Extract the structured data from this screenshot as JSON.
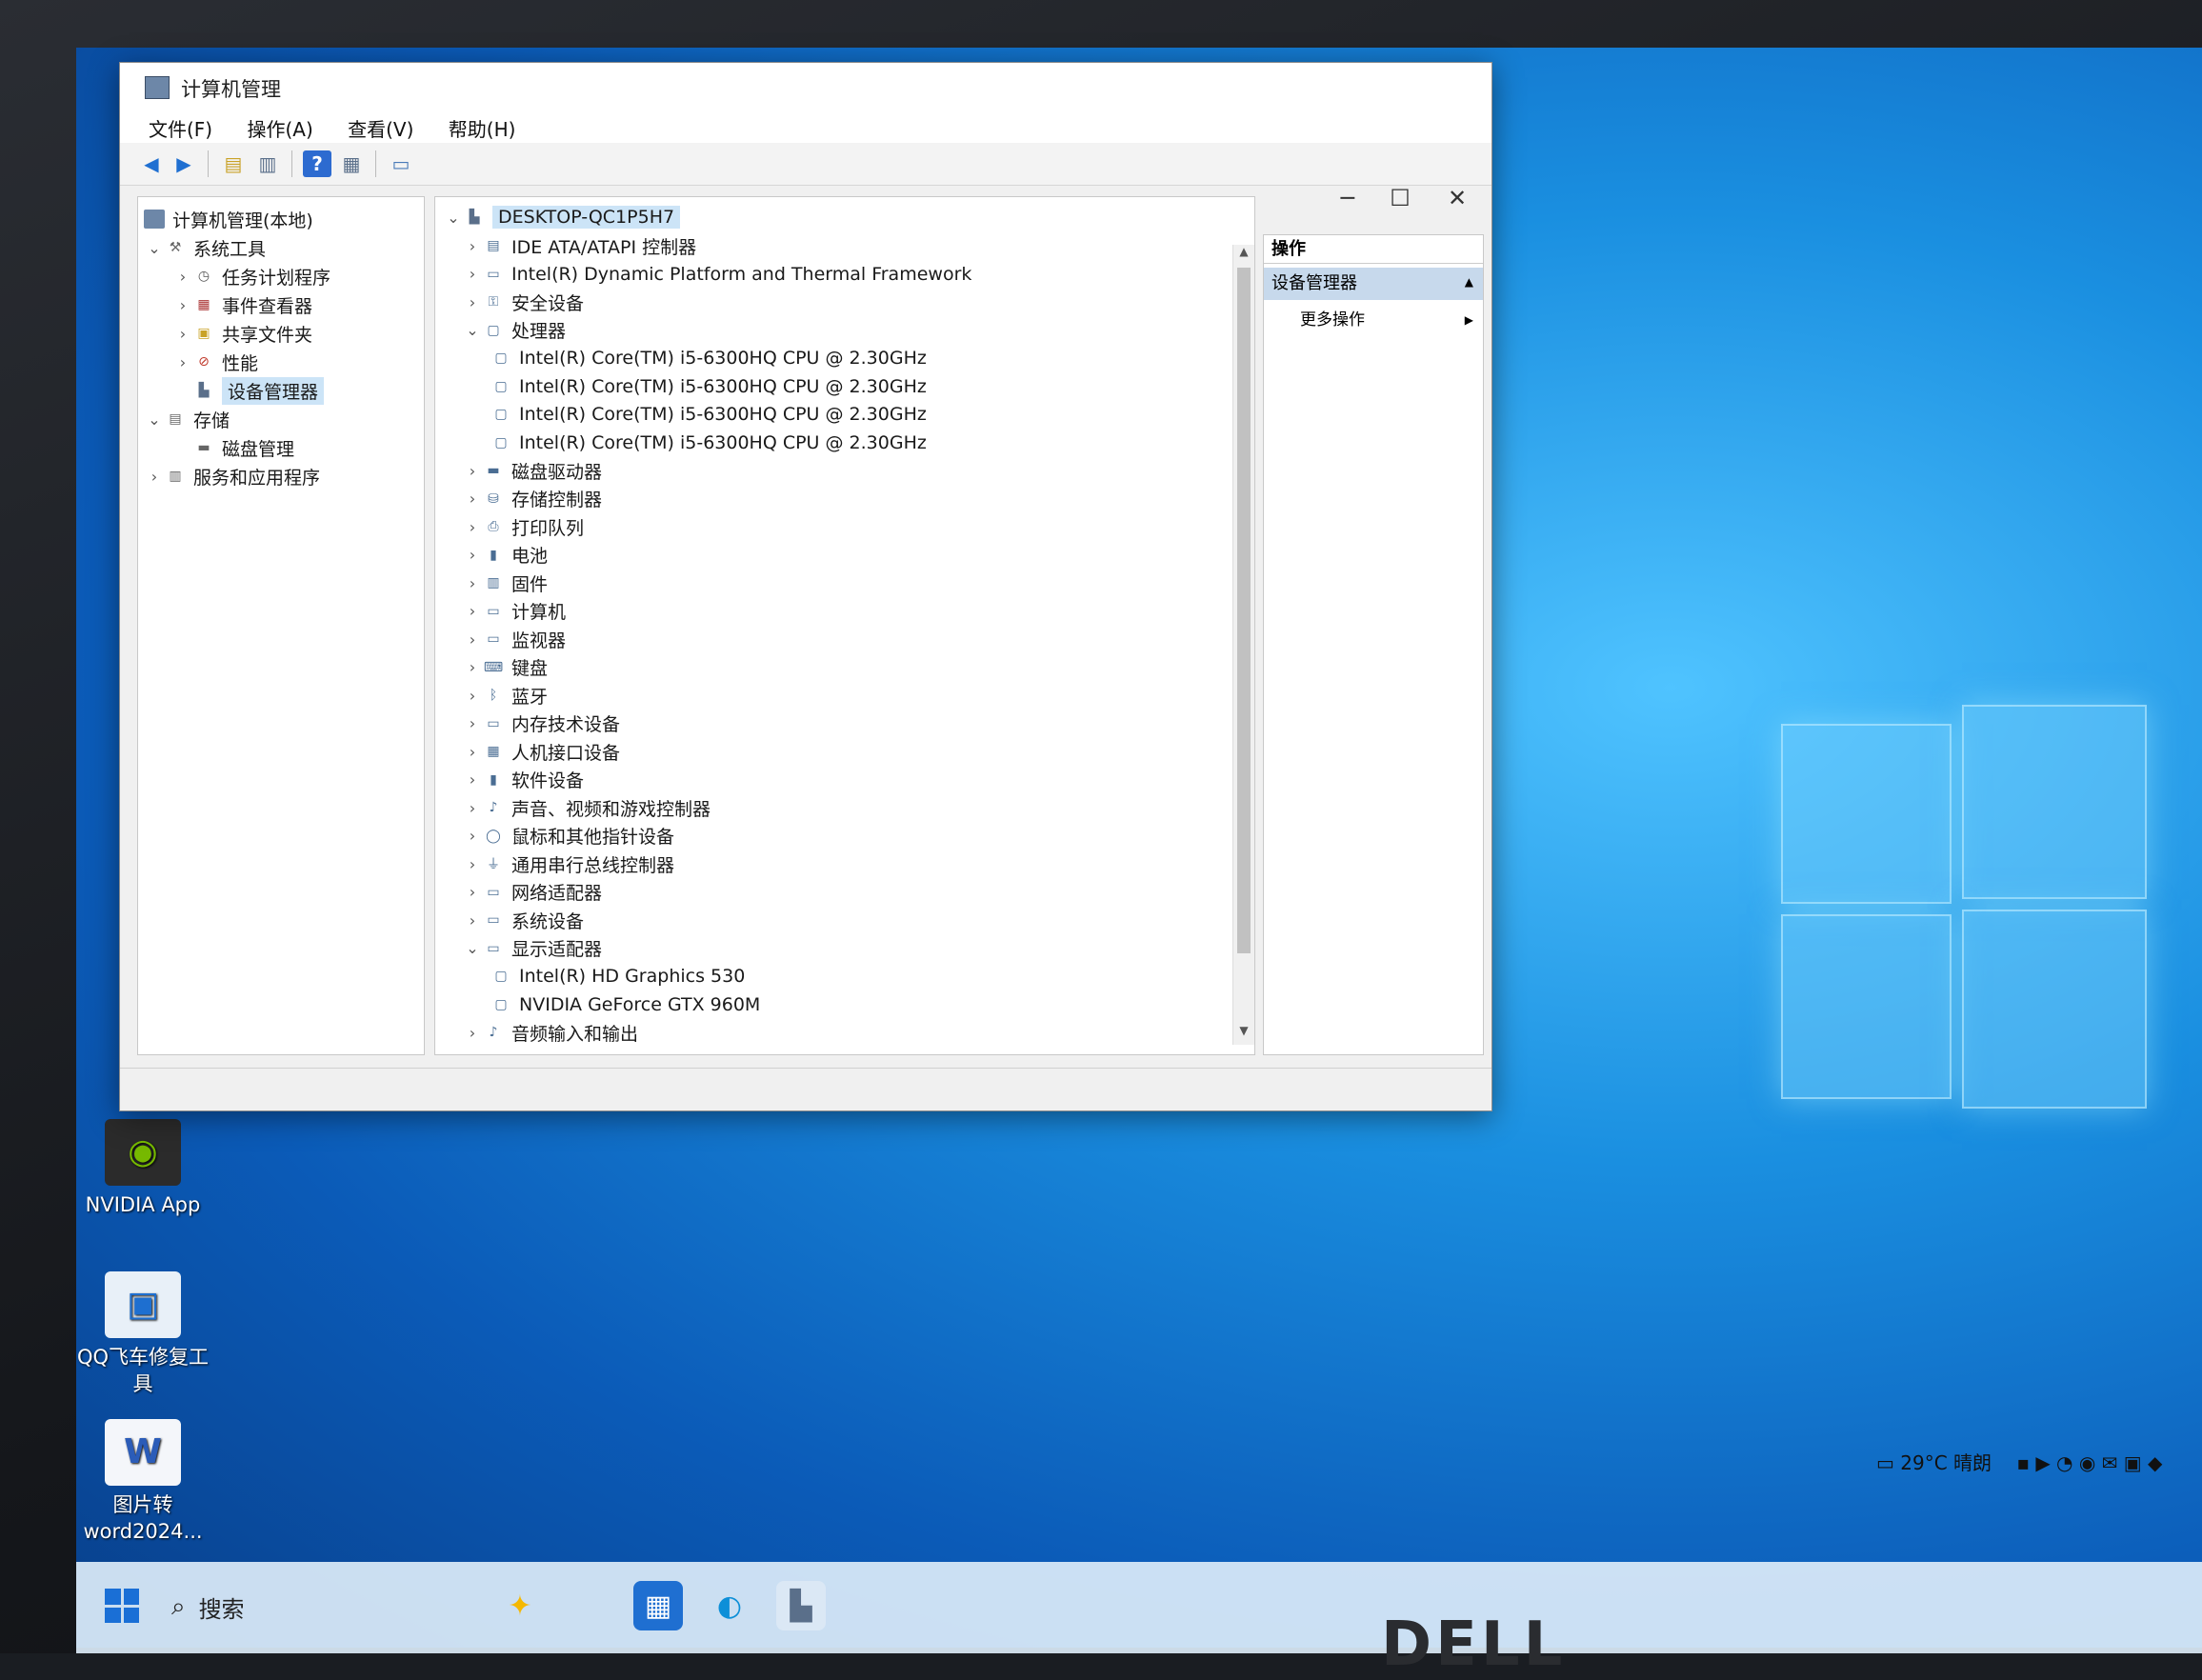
{
  "window": {
    "title": "计算机管理",
    "menu": [
      "文件(F)",
      "操作(A)",
      "查看(V)",
      "帮助(H)"
    ],
    "controls": {
      "minimize": "─",
      "maximize": "☐",
      "close": "✕"
    }
  },
  "left_tree": [
    {
      "label": "计算机管理(本地)",
      "level": 0,
      "chevron": ""
    },
    {
      "label": "系统工具",
      "level": 1,
      "chevron": "⌄"
    },
    {
      "label": "任务计划程序",
      "level": 2,
      "chevron": "›"
    },
    {
      "label": "事件查看器",
      "level": 2,
      "chevron": "›"
    },
    {
      "label": "共享文件夹",
      "level": 2,
      "chevron": "›"
    },
    {
      "label": "性能",
      "level": 2,
      "chevron": "›"
    },
    {
      "label": "设备管理器",
      "level": 2,
      "chevron": "",
      "selected": true
    },
    {
      "label": "存储",
      "level": 1,
      "chevron": "⌄"
    },
    {
      "label": "磁盘管理",
      "level": 2,
      "chevron": ""
    },
    {
      "label": "服务和应用程序",
      "level": 1,
      "chevron": "›"
    }
  ],
  "device_tree": {
    "root": "DESKTOP-QC1P5H7",
    "items": [
      {
        "label": "IDE ATA/ATAPI 控制器",
        "chevron": "›",
        "indent": 1
      },
      {
        "label": "Intel(R) Dynamic Platform and Thermal Framework",
        "chevron": "›",
        "indent": 1
      },
      {
        "label": "安全设备",
        "chevron": "›",
        "indent": 1
      },
      {
        "label": "处理器",
        "chevron": "⌄",
        "indent": 1
      },
      {
        "label": "Intel(R) Core(TM) i5-6300HQ CPU @ 2.30GHz",
        "chevron": "",
        "indent": 2
      },
      {
        "label": "Intel(R) Core(TM) i5-6300HQ CPU @ 2.30GHz",
        "chevron": "",
        "indent": 2
      },
      {
        "label": "Intel(R) Core(TM) i5-6300HQ CPU @ 2.30GHz",
        "chevron": "",
        "indent": 2
      },
      {
        "label": "Intel(R) Core(TM) i5-6300HQ CPU @ 2.30GHz",
        "chevron": "",
        "indent": 2
      },
      {
        "label": "磁盘驱动器",
        "chevron": "›",
        "indent": 1
      },
      {
        "label": "存储控制器",
        "chevron": "›",
        "indent": 1
      },
      {
        "label": "打印队列",
        "chevron": "›",
        "indent": 1
      },
      {
        "label": "电池",
        "chevron": "›",
        "indent": 1
      },
      {
        "label": "固件",
        "chevron": "›",
        "indent": 1
      },
      {
        "label": "计算机",
        "chevron": "›",
        "indent": 1
      },
      {
        "label": "监视器",
        "chevron": "›",
        "indent": 1
      },
      {
        "label": "键盘",
        "chevron": "›",
        "indent": 1
      },
      {
        "label": "蓝牙",
        "chevron": "›",
        "indent": 1
      },
      {
        "label": "内存技术设备",
        "chevron": "›",
        "indent": 1
      },
      {
        "label": "人机接口设备",
        "chevron": "›",
        "indent": 1
      },
      {
        "label": "软件设备",
        "chevron": "›",
        "indent": 1
      },
      {
        "label": "声音、视频和游戏控制器",
        "chevron": "›",
        "indent": 1
      },
      {
        "label": "鼠标和其他指针设备",
        "chevron": "›",
        "indent": 1
      },
      {
        "label": "通用串行总线控制器",
        "chevron": "›",
        "indent": 1
      },
      {
        "label": "网络适配器",
        "chevron": "›",
        "indent": 1
      },
      {
        "label": "系统设备",
        "chevron": "›",
        "indent": 1
      },
      {
        "label": "显示适配器",
        "chevron": "⌄",
        "indent": 1
      },
      {
        "label": "Intel(R) HD Graphics 530",
        "chevron": "",
        "indent": 2
      },
      {
        "label": "NVIDIA GeForce GTX 960M",
        "chevron": "",
        "indent": 2
      },
      {
        "label": "音频输入和输出",
        "chevron": "›",
        "indent": 1
      }
    ]
  },
  "actions_pane": {
    "header": "操作",
    "section": "设备管理器",
    "more": "更多操作"
  },
  "desktop_icons": [
    {
      "label": "NVIDIA App"
    },
    {
      "label": "QQ飞车修复工具"
    },
    {
      "label": "图片转word2024..."
    }
  ],
  "taskbar": {
    "search_placeholder": "搜索",
    "weather": "29°C 晴朗"
  },
  "brand": "DELL",
  "colors": {
    "selection": "#cce4f7",
    "actions_section": "#c7d9ec",
    "desktop_accent": "#1a8fe0"
  }
}
